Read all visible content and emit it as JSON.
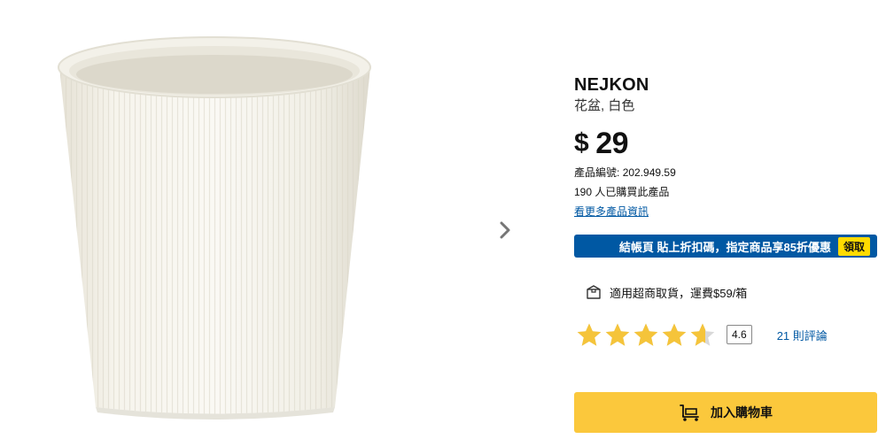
{
  "product": {
    "name": "NEJKON",
    "description": "花盆, 白色",
    "currency": "$",
    "price": "29",
    "article_label": "產品編號:",
    "article_number": "202.949.59",
    "bought_text": "190 人已購買此產品",
    "more_info_link": "看更多產品資訊"
  },
  "promo": {
    "text": "結帳頁 貼上折扣碼，指定商品享85折優惠",
    "claim_label": "領取"
  },
  "pickup": {
    "text": "適用超商取貨，運費$59/箱",
    "icon": "package-icon"
  },
  "rating": {
    "value": "4.6",
    "stars": 4.6,
    "max_stars": 5,
    "reviews_link": "21 則評論"
  },
  "cart": {
    "add_label": "加入購物車",
    "icon": "cart-icon"
  },
  "colors": {
    "brand_blue": "#0058a3",
    "brand_yellow": "#fbc83c",
    "star_fill": "#f5c43a",
    "star_empty": "#d8d8d8"
  }
}
